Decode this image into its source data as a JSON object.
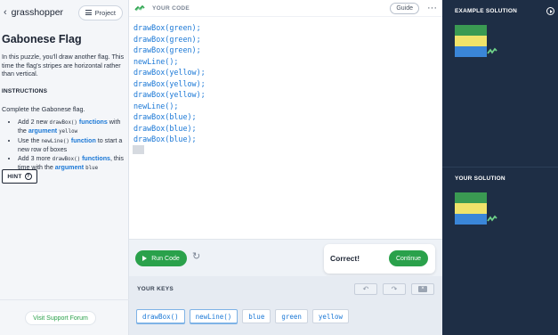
{
  "colors": {
    "brand_green": "#2aa14b",
    "code_blue": "#1b78d6",
    "right_panel": "#1e2e45",
    "flag_green": "#3a9a52",
    "flag_yellow": "#f0e36a",
    "flag_blue": "#3a86d8"
  },
  "left": {
    "brand": "grasshopper",
    "project_label": "Project",
    "title": "Gabonese Flag",
    "intro": "In this puzzle, you'll draw another flag. This time the flag's stripes are horizontal rather than vertical.",
    "instructions_heading": "INSTRUCTIONS",
    "instructions_text": "Complete the Gabonese flag.",
    "bullets": [
      {
        "a": "Add 2 new ",
        "code": "drawBox()",
        "hl1": "functions",
        "b": " with the ",
        "hl2": "argument",
        "code2": "yellow"
      },
      {
        "a": "Use the ",
        "code": "newLine()",
        "hl1": "function",
        "b": " to start a new row of boxes"
      },
      {
        "a": "Add 3 more ",
        "code": "drawBox()",
        "hl1": "functions",
        "b": ", this time with the ",
        "hl2": "argument",
        "code2": "blue"
      }
    ],
    "hint_label": "HINT",
    "forum_label": "Visit Support Forum"
  },
  "editor": {
    "header_label": "YOUR CODE",
    "guide_label": "Guide",
    "code_lines": [
      "drawBox(green);",
      "drawBox(green);",
      "drawBox(green);",
      "newLine();",
      "drawBox(yellow);",
      "drawBox(yellow);",
      "drawBox(yellow);",
      "newLine();",
      "drawBox(blue);",
      "drawBox(blue);",
      "drawBox(blue);"
    ],
    "run_label": "Run Code",
    "correct_label": "Correct!",
    "continue_label": "Continue",
    "keys_label": "YOUR KEYS",
    "keys": [
      "drawBox()",
      "newLine()",
      "blue",
      "green",
      "yellow"
    ]
  },
  "right": {
    "example_title": "EXAMPLE SOLUTION",
    "your_title": "YOUR SOLUTION"
  }
}
